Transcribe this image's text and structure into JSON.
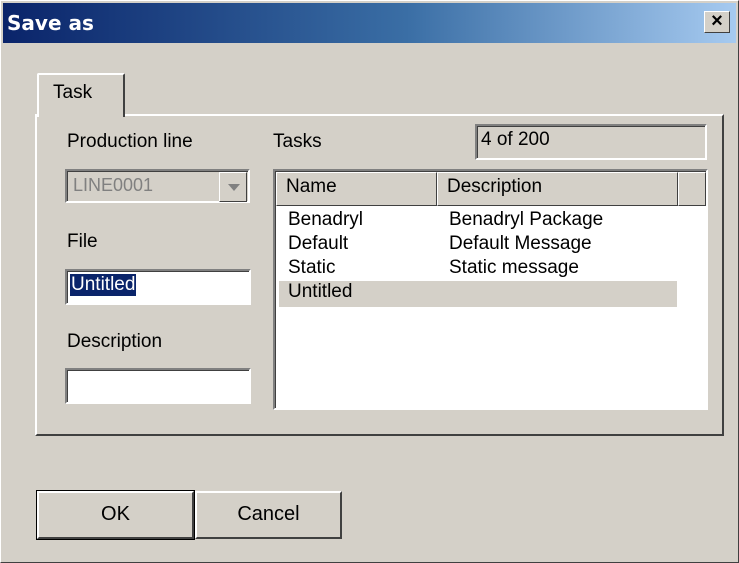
{
  "window": {
    "title": "Save as",
    "close_label": "×"
  },
  "tabs": [
    {
      "label": "Task",
      "active": true
    }
  ],
  "production_line": {
    "label": "Production line",
    "value": "LINE0001"
  },
  "file": {
    "label": "File",
    "value": "Untitled"
  },
  "description": {
    "label": "Description",
    "value": ""
  },
  "tasks": {
    "label": "Tasks",
    "count": "4 of 200",
    "columns": [
      "Name",
      "Description"
    ],
    "rows": [
      {
        "name": "Benadryl",
        "description": "Benadryl Package"
      },
      {
        "name": "Default",
        "description": "Default Message"
      },
      {
        "name": "Static",
        "description": "Static message"
      },
      {
        "name": "Untitled",
        "description": "",
        "highlighted": true
      }
    ]
  },
  "buttons": {
    "ok": "OK",
    "cancel": "Cancel"
  }
}
